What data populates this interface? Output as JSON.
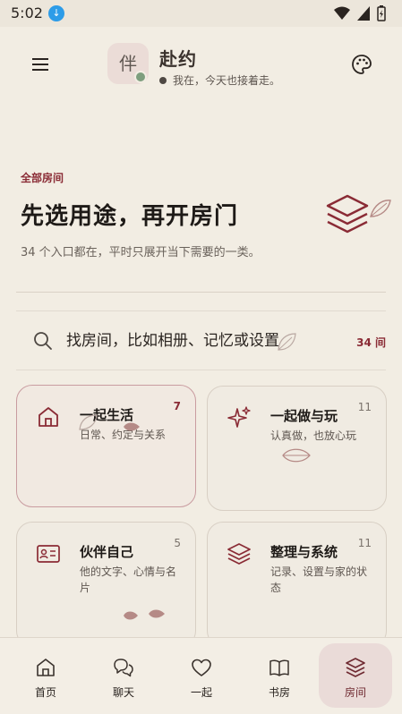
{
  "status_bar": {
    "time": "5:02"
  },
  "header": {
    "app_name": "赴约",
    "status_text": "我在，今天也接着走。",
    "avatar_char": "伴"
  },
  "hero": {
    "kicker": "全部房间",
    "title": "先选用途，再开房门",
    "subtitle": "34 个入口都在，平时只展开当下需要的一类。"
  },
  "search": {
    "placeholder": "找房间，比如相册、记忆或设置",
    "count": "34 间"
  },
  "cards": [
    {
      "title": "一起生活",
      "desc": "日常、约定与关系",
      "count": "7",
      "icon": "home-icon",
      "active": true
    },
    {
      "title": "一起做与玩",
      "desc": "认真做，也放心玩",
      "count": "11",
      "icon": "sparkle-icon",
      "active": false
    },
    {
      "title": "伙伴自己",
      "desc": "他的文字、心情与名片",
      "count": "5",
      "icon": "id-card-icon",
      "active": false
    },
    {
      "title": "整理与系统",
      "desc": "记录、设置与家的状态",
      "count": "11",
      "icon": "layers-icon",
      "active": false
    }
  ],
  "bottom_nav": {
    "items": [
      {
        "label": "首页",
        "icon": "home-icon"
      },
      {
        "label": "聊天",
        "icon": "chat-icon"
      },
      {
        "label": "一起",
        "icon": "heart-icon"
      },
      {
        "label": "书房",
        "icon": "book-icon"
      },
      {
        "label": "房间",
        "icon": "layers-icon",
        "active": true
      }
    ]
  },
  "colors": {
    "background": "#F2EDE3",
    "accent": "#8A2B35",
    "active_card_border": "#C99CA0",
    "nav_active_bg": "#EADBD8"
  }
}
